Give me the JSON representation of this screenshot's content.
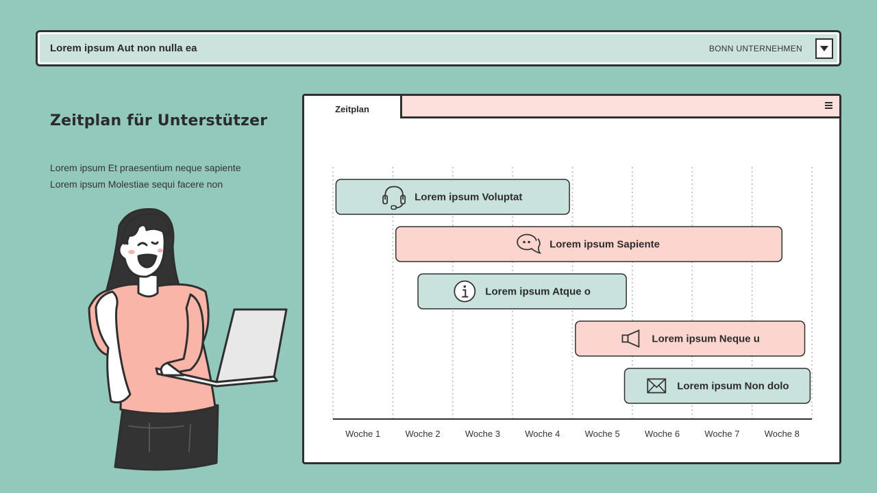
{
  "header": {
    "title": "Lorem ipsum Aut non nulla ea",
    "company": "BONN UNTERNEHMEN"
  },
  "left": {
    "heading": "Zeitplan für Unterstützer",
    "lines": [
      "Lorem ipsum Et praesentium neque sapiente",
      "Lorem ipsum Molestiae sequi facere non"
    ]
  },
  "panel": {
    "tab_label": "Zeitplan"
  },
  "colors": {
    "background": "#93c8bc",
    "mint": "#c9e2dd",
    "pink": "#fdd5cf",
    "dark": "#2f2f2f"
  },
  "chart_data": {
    "type": "gantt",
    "weeks": [
      "Woche 1",
      "Woche 2",
      "Woche 3",
      "Woche 4",
      "Woche 5",
      "Woche 6",
      "Woche 7",
      "Woche 8"
    ],
    "tasks": [
      {
        "label": "Lorem ipsum Voluptat",
        "start": 0.05,
        "end": 3.95,
        "color": "#c9e2dd",
        "icon": "headset-icon"
      },
      {
        "label": "Lorem ipsum Sapiente",
        "start": 1.05,
        "end": 7.5,
        "color": "#fdd5cf",
        "icon": "chat-icon"
      },
      {
        "label": "Lorem ipsum Atque o",
        "start": 1.42,
        "end": 4.9,
        "color": "#c9e2dd",
        "icon": "info-icon"
      },
      {
        "label": "Lorem ipsum Neque u",
        "start": 4.05,
        "end": 7.88,
        "color": "#fdd5cf",
        "icon": "megaphone-icon"
      },
      {
        "label": "Lorem ipsum Non dolo",
        "start": 4.87,
        "end": 7.97,
        "color": "#c9e2dd",
        "icon": "mail-icon"
      }
    ]
  }
}
